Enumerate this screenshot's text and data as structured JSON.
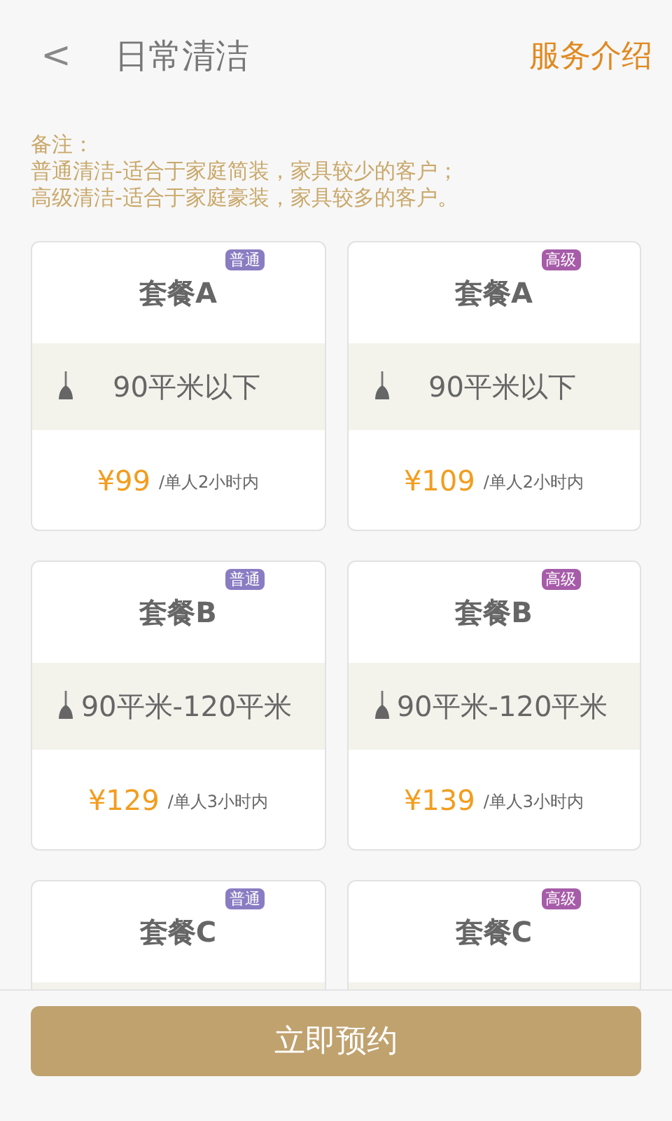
{
  "header": {
    "back": "<",
    "title": "日常清洁",
    "action": "服务介绍"
  },
  "note": {
    "label": "备注：",
    "lines": [
      "普通清洁-适合于家庭简装，家具较少的客户；",
      "高级清洁-适合于家庭豪装，家具较多的客户。"
    ]
  },
  "packages": [
    {
      "name": "套餐A",
      "tag": {
        "text": "普通",
        "color": "#8a7cc2"
      },
      "area": "90平米以下",
      "price": "¥99",
      "unit": "/单人2小时内"
    },
    {
      "name": "套餐A",
      "tag": {
        "text": "高级",
        "color": "#a65ca8"
      },
      "area": "90平米以下",
      "price": "¥109",
      "unit": "/单人2小时内"
    },
    {
      "name": "套餐B",
      "tag": {
        "text": "普通",
        "color": "#8a7cc2"
      },
      "area": "90平米-120平米",
      "price": "¥129",
      "unit": "/单人3小时内"
    },
    {
      "name": "套餐B",
      "tag": {
        "text": "高级",
        "color": "#a65ca8"
      },
      "area": "90平米-120平米",
      "price": "¥139",
      "unit": "/单人3小时内"
    },
    {
      "name": "套餐C",
      "tag": {
        "text": "普通",
        "color": "#8a7cc2"
      }
    },
    {
      "name": "套餐C",
      "tag": {
        "text": "高级",
        "color": "#a65ca8"
      }
    }
  ],
  "book_button": "立即预约"
}
